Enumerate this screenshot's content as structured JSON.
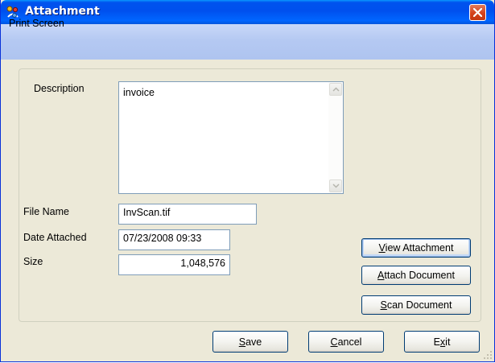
{
  "window": {
    "title": "Attachment",
    "icon": "attachment-app-icon",
    "close_icon": "close-icon"
  },
  "menu": {
    "items": [
      {
        "label": "Print Screen"
      }
    ]
  },
  "form": {
    "description_label": "Description",
    "description_value": "invoice",
    "file_name_label": "File Name",
    "file_name_value": "InvScan.tif",
    "date_attached_label": "Date Attached",
    "date_attached_value": "07/23/2008 09:33",
    "size_label": "Size",
    "size_value": "1,048,576"
  },
  "side_buttons": {
    "view_attachment": {
      "accel": "V",
      "rest": "iew Attachment"
    },
    "attach_document": {
      "accel": "A",
      "rest": "ttach Document"
    },
    "scan_document": {
      "pre": "",
      "accel": "S",
      "rest": "can Document"
    }
  },
  "footer_buttons": {
    "save": {
      "accel": "S",
      "rest": "ave"
    },
    "cancel": {
      "accel": "C",
      "rest": "ancel"
    },
    "exit": {
      "pre": "E",
      "accel": "x",
      "rest": "it"
    }
  },
  "colors": {
    "title_bar": "#0055ea",
    "menu_bar": "#b5c9f2",
    "dialog_face": "#ece9d8",
    "close_button": "#d4421b"
  }
}
